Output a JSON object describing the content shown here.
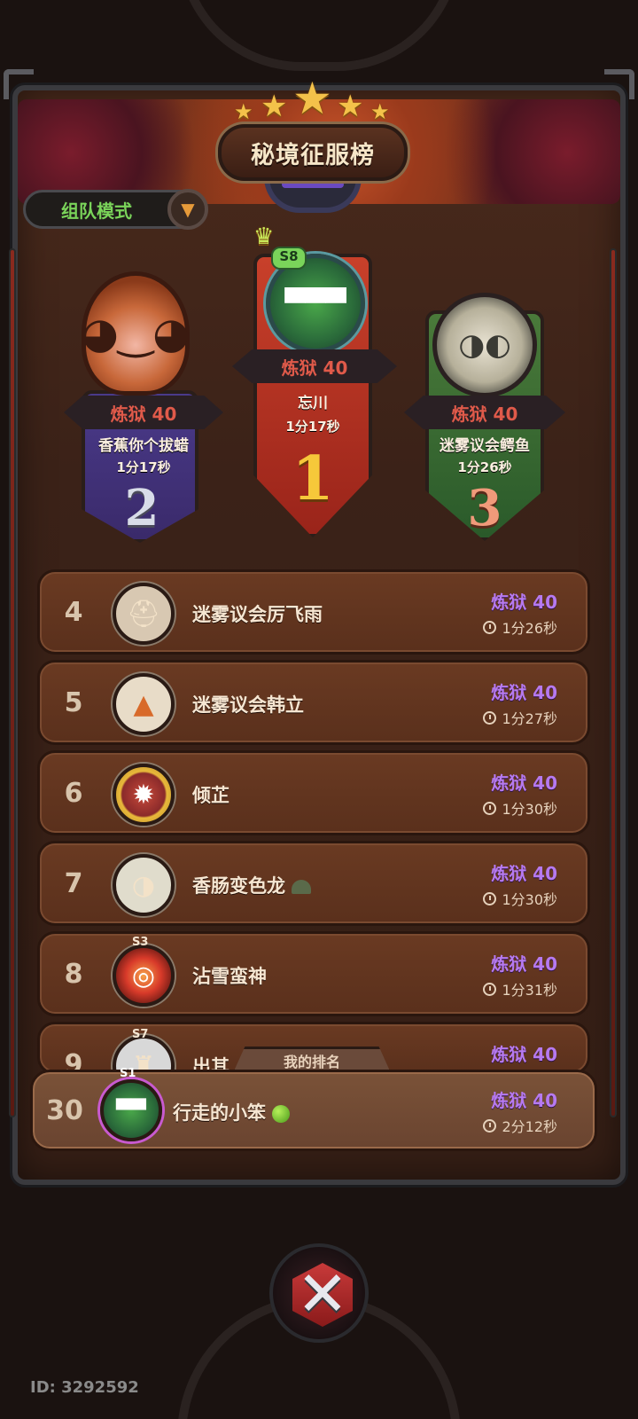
{
  "header": {
    "title": "秘境征服榜",
    "stars": 5
  },
  "mode_selector": {
    "label": "组队模式"
  },
  "podium": {
    "first": {
      "rank": "1",
      "level": "炼狱 40",
      "name": "忘川",
      "time": "1分17秒",
      "season_badge": "S8",
      "avatar_icon": "green-grin-icon"
    },
    "second": {
      "rank": "2",
      "level": "炼狱 40",
      "name": "香蕉你个拔蜡",
      "time": "1分17秒",
      "avatar_icon": "boar-hood-icon"
    },
    "third": {
      "rank": "3",
      "level": "炼狱 40",
      "name": "迷雾议会鳄鱼",
      "time": "1分26秒",
      "avatar_icon": "horned-elf-icon"
    }
  },
  "leaderboard": [
    {
      "rank": "4",
      "name": "迷雾议会厉飞雨",
      "level": "炼狱 40",
      "time": "1分26秒",
      "avatar_icon": "helmet-warrior-icon"
    },
    {
      "rank": "5",
      "name": "迷雾议会韩立",
      "level": "炼狱 40",
      "time": "1分27秒",
      "avatar_icon": "fox-cub-icon"
    },
    {
      "rank": "6",
      "name": "倾芷",
      "level": "炼狱 40",
      "time": "1分30秒",
      "avatar_icon": "sun-frame-icon"
    },
    {
      "rank": "7",
      "name": "香肠变色龙",
      "level": "炼狱 40",
      "time": "1分30秒",
      "avatar_icon": "horned-elf-icon",
      "suffix_icon": "helmet-emoji-icon"
    },
    {
      "rank": "8",
      "name": "沾雪蛮神",
      "level": "炼狱 40",
      "time": "1分31秒",
      "avatar_icon": "fire-orb-icon",
      "season_badge": "S3"
    },
    {
      "rank": "9",
      "name": "出其",
      "level": "炼狱 40",
      "time": "",
      "avatar_icon": "viking-icon",
      "season_badge": "S7"
    }
  ],
  "my_rank": {
    "tab_label": "我的排名",
    "rank": "30",
    "name": "行走的小笨",
    "level": "炼狱 40",
    "time": "2分12秒",
    "season_badge": "S1",
    "suffix_icon": "green-apple-icon"
  },
  "footer": {
    "user_id": "ID: 3292592"
  },
  "colors": {
    "level_purple": "#b67af0",
    "level_red": "#e05a4a",
    "mode_green": "#7ad45a",
    "gold": "#f4c24a"
  }
}
